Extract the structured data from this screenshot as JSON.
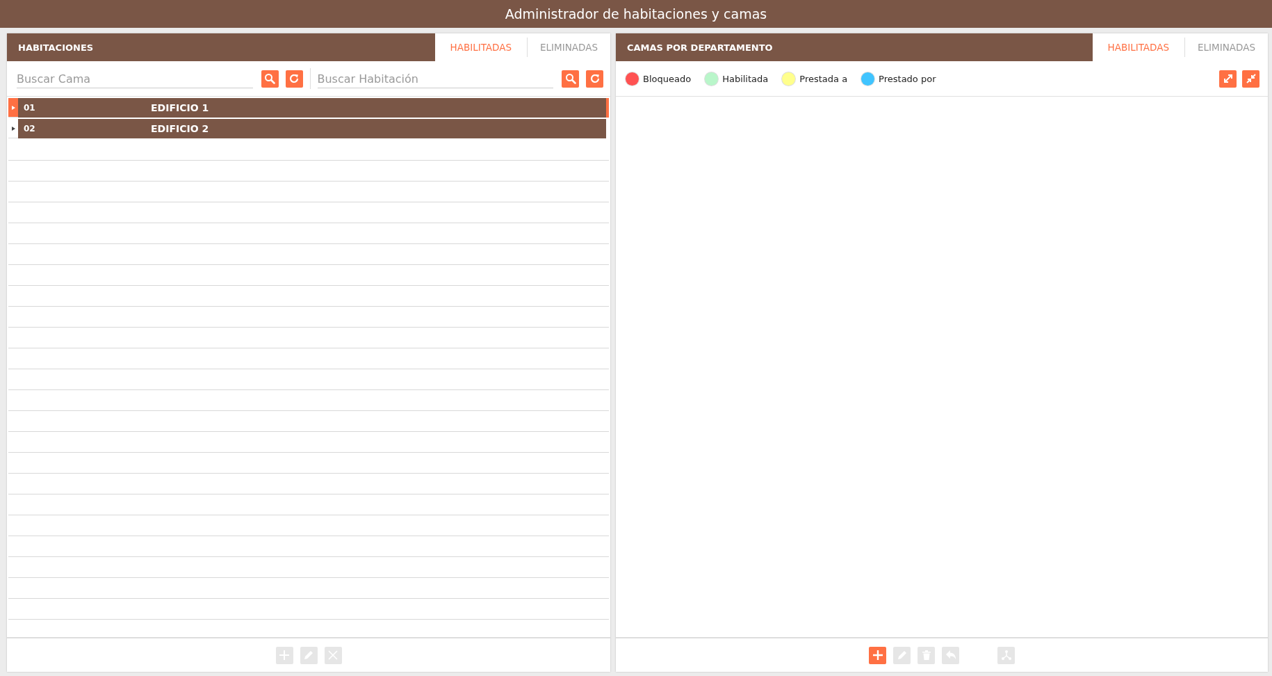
{
  "window": {
    "title": "Administrador de habitaciones y camas"
  },
  "rooms_panel": {
    "title": "HABITACIONES",
    "tabs": [
      {
        "label": "HABILITADAS",
        "selected": true
      },
      {
        "label": "ELIMINADAS",
        "selected": false
      }
    ],
    "searches": [
      {
        "placeholder": "Buscar Cama"
      },
      {
        "placeholder": "Buscar Habitación"
      }
    ],
    "rows": [
      {
        "code": "01",
        "name": "EDIFICIO 1",
        "selected": true,
        "expanded": false
      },
      {
        "code": "02",
        "name": "EDIFICIO 2",
        "selected": false,
        "expanded": false
      }
    ],
    "toolbar": [
      {
        "kind": "add",
        "disabled": true
      },
      {
        "kind": "edit",
        "disabled": true
      },
      {
        "kind": "close",
        "disabled": true
      }
    ]
  },
  "beds_panel": {
    "title": "CAMAS POR DEPARTAMENTO",
    "tabs": [
      {
        "label": "HABILITADAS",
        "selected": true
      },
      {
        "label": "ELIMINADAS",
        "selected": false
      }
    ],
    "legend": [
      {
        "label": "Bloqueado",
        "color": "#ff5252"
      },
      {
        "label": "Habilitada",
        "color": "#b9f6ca"
      },
      {
        "label": "Prestada a",
        "color": "#ffff8d"
      },
      {
        "label": "Prestado por",
        "color": "#40c4ff"
      }
    ],
    "toolbar": [
      {
        "kind": "add",
        "disabled": false
      },
      {
        "kind": "edit",
        "disabled": true
      },
      {
        "kind": "delete",
        "disabled": true
      },
      {
        "kind": "undo",
        "disabled": true
      },
      {
        "kind": "tree",
        "disabled": true
      }
    ]
  }
}
